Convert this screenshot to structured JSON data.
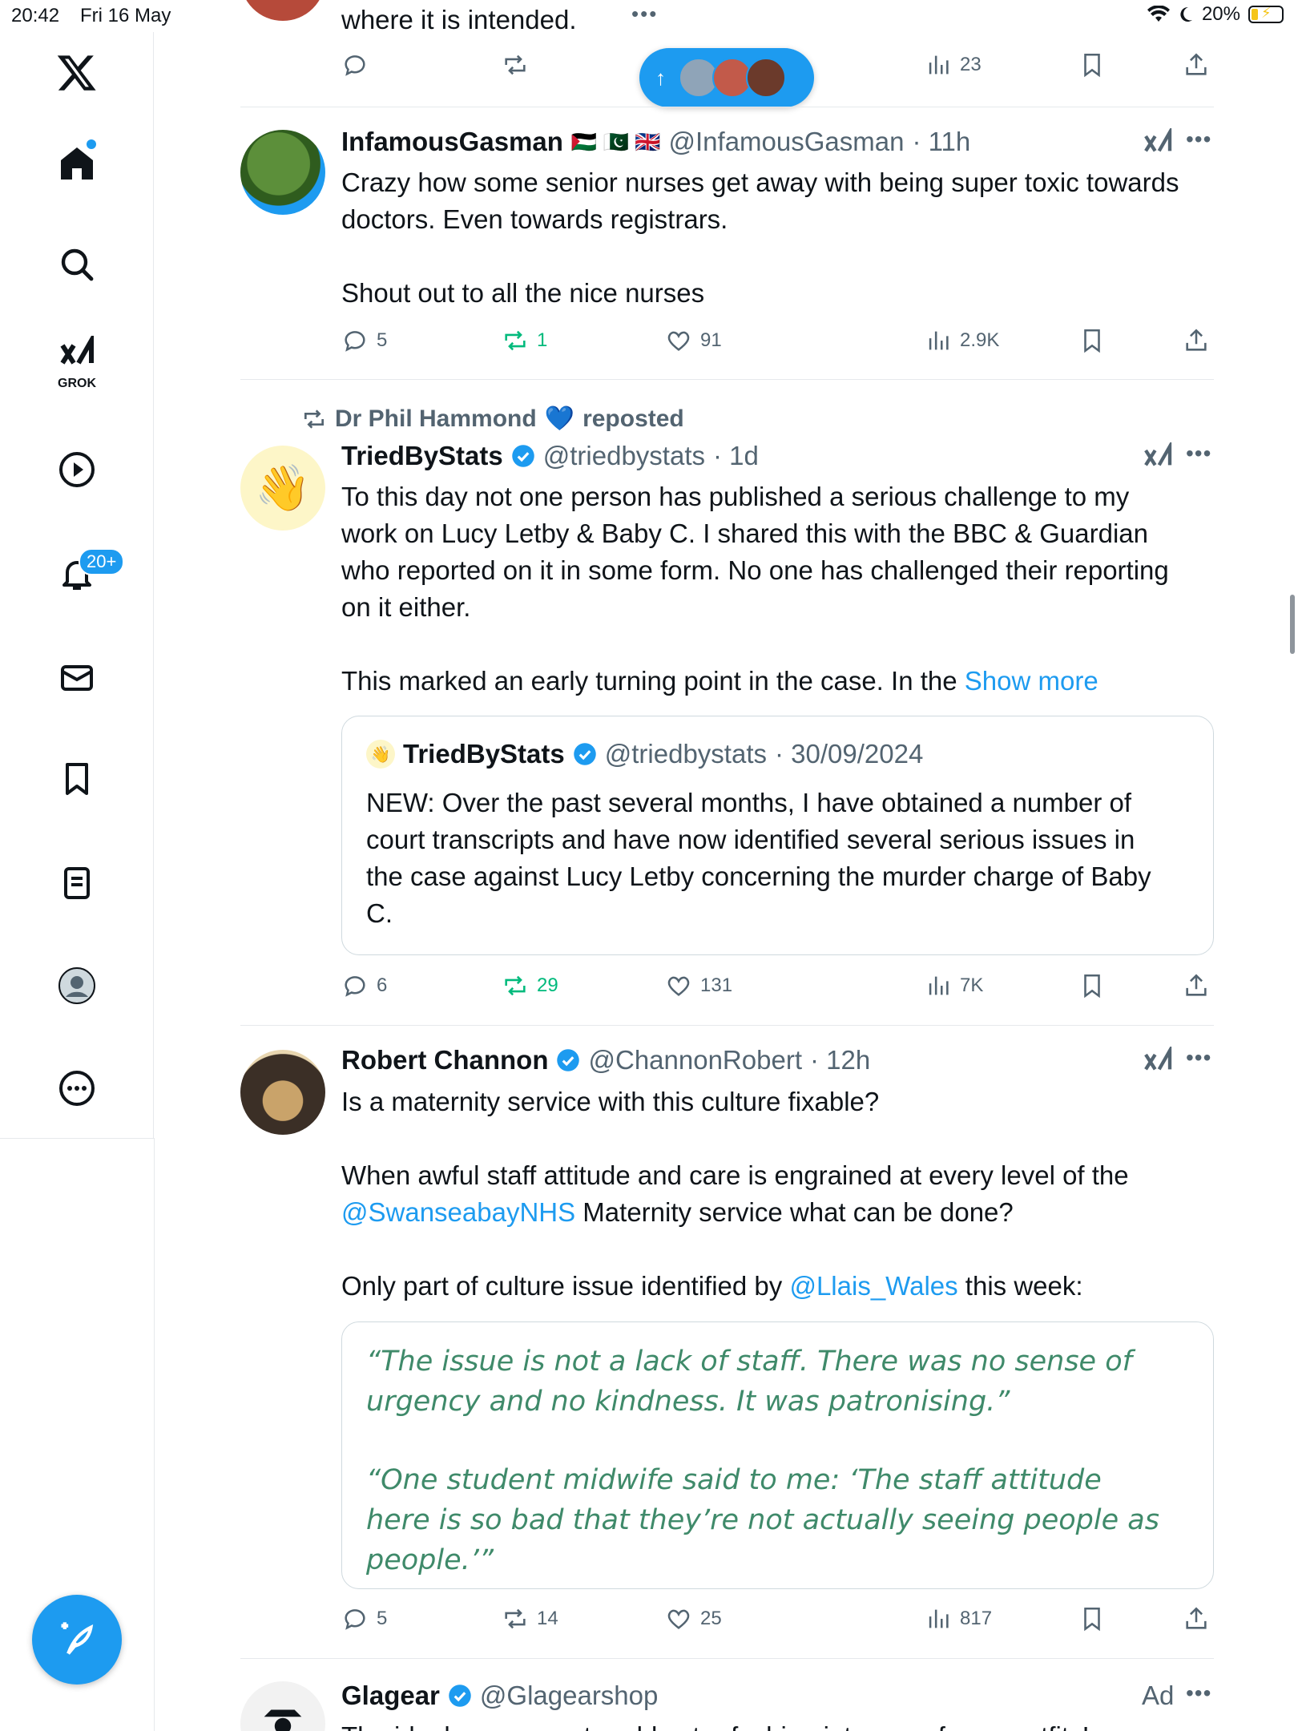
{
  "status_bar": {
    "time": "20:42",
    "date": "Fri 16 May",
    "battery": "20%"
  },
  "sidebar": {
    "grok_label": "GROK",
    "notifications_badge": "20+"
  },
  "top_partial": {
    "text": "where it is intended.",
    "views": "23"
  },
  "new_posts_pill": {
    "arrow": "↑"
  },
  "tweets": [
    {
      "name": "InfamousGasman",
      "flags": "🇵🇸 🇵🇰 🇬🇧",
      "handle": "@InfamousGasman",
      "time": "· 11h",
      "para1": "Crazy how some senior nurses get away with being super toxic towards",
      "para1b": "doctors. Even towards registrars.",
      "para2": "Shout out to all the nice nurses",
      "replies": "5",
      "reposts": "1",
      "likes": "91",
      "views": "2.9K"
    },
    {
      "repost_by": "Dr Phil Hammond",
      "repost_heart": "💙",
      "repost_label": "reposted",
      "name": "TriedByStats",
      "handle": "@triedbystats",
      "time": "· 1d",
      "lines": [
        "To this day not one person has published a serious challenge to my",
        "work on Lucy Letby & Baby C. I shared this with the BBC & Guardian",
        "who reported on it in some form. No one has challenged their reporting",
        "on it either."
      ],
      "para2": "This marked an early turning point in the case. In the",
      "show_more": "Show more",
      "quote": {
        "name": "TriedByStats",
        "handle": "@triedbystats",
        "time": "· 30/09/2024",
        "lines": [
          "NEW: Over the past several months, I have obtained a number of",
          "court transcripts and have now identified several serious issues in",
          "the case against Lucy Letby concerning the murder charge of Baby",
          "C."
        ]
      },
      "replies": "6",
      "reposts": "29",
      "likes": "131",
      "views": "7K"
    },
    {
      "name": "Robert Channon",
      "handle": "@ChannonRobert",
      "time": "· 12h",
      "line1": "Is a maternity service with this culture fixable?",
      "line2": "When awful staff attitude and care is engrained at every level of the",
      "mention1": "@SwanseabayNHS",
      "line3_rest": " Maternity service what can be done?",
      "line4_pre": "Only part of culture issue identified by ",
      "mention2": "@Llais_Wales",
      "line4_post": " this week:",
      "image_quote": {
        "q1a": "“The issue is not a lack of staff. There was no sense of",
        "q1b": "urgency and no kindness. It was patronising.”",
        "q2a": "“One student midwife said to me: ‘The staff attitude",
        "q2b": "here is so bad that they’re not actually seeing people as",
        "q2c": "people.’”"
      },
      "replies": "5",
      "reposts": "14",
      "likes": "25",
      "views": "817"
    },
    {
      "name": "Glagear",
      "handle": "@Glagearshop",
      "ad_label": "Ad",
      "partial_text": "The ideal accessory to add extra fashion into any of your outfits!"
    }
  ],
  "colors": {
    "accent": "#1d9bf0",
    "repost_green": "#00ba7c",
    "muted": "#536471",
    "quote_green": "#3f8a6a"
  }
}
